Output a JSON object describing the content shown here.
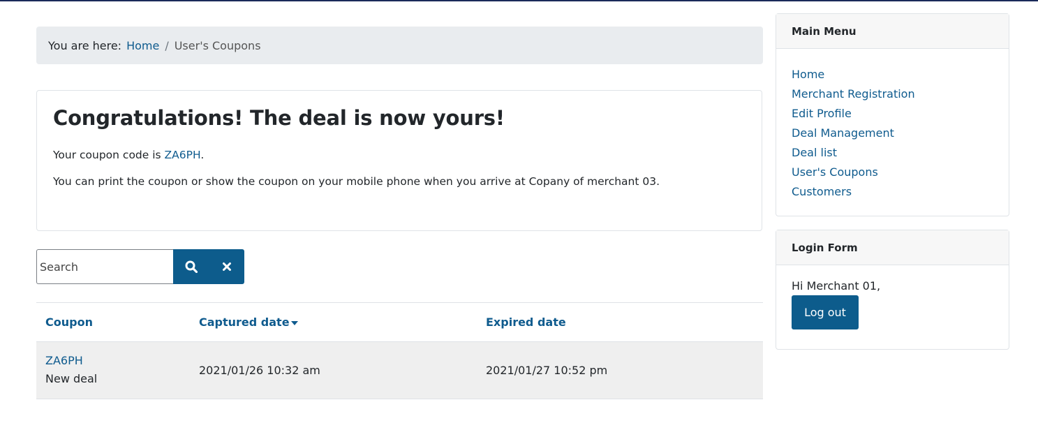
{
  "breadcrumb": {
    "prefix": "You are here:",
    "home": "Home",
    "separator": "/",
    "current": "User's Coupons"
  },
  "alert": {
    "heading": "Congratulations! The deal is now yours!",
    "code_prefix": "Your coupon code is ",
    "code": "ZA6PH",
    "code_suffix": ".",
    "message": "You can print the coupon or show the coupon on your mobile phone when you arrive at Copany of merchant 03."
  },
  "search": {
    "placeholder": "Search",
    "value": "",
    "search_icon": "search-icon",
    "clear_icon": "close-icon"
  },
  "table": {
    "headers": [
      "Coupon",
      "Captured date",
      "Expired date"
    ],
    "rows": [
      {
        "code": "ZA6PH",
        "title": "New deal",
        "captured": "2021/01/26 10:32 am",
        "expired": "2021/01/27 10:52 pm"
      }
    ]
  },
  "main_menu": {
    "title": "Main Menu",
    "items": [
      "Home",
      "Merchant Registration",
      "Edit Profile",
      "Deal Management",
      "Deal list",
      "User's Coupons",
      "Customers"
    ]
  },
  "login_form": {
    "title": "Login Form",
    "greeting": "Hi Merchant 01,",
    "logout_label": "Log out"
  },
  "colors": {
    "accent": "#0d5c8c",
    "link": "#0f5b8e",
    "breadcrumb_bg": "#e9ecef",
    "row_bg": "#efefef"
  }
}
